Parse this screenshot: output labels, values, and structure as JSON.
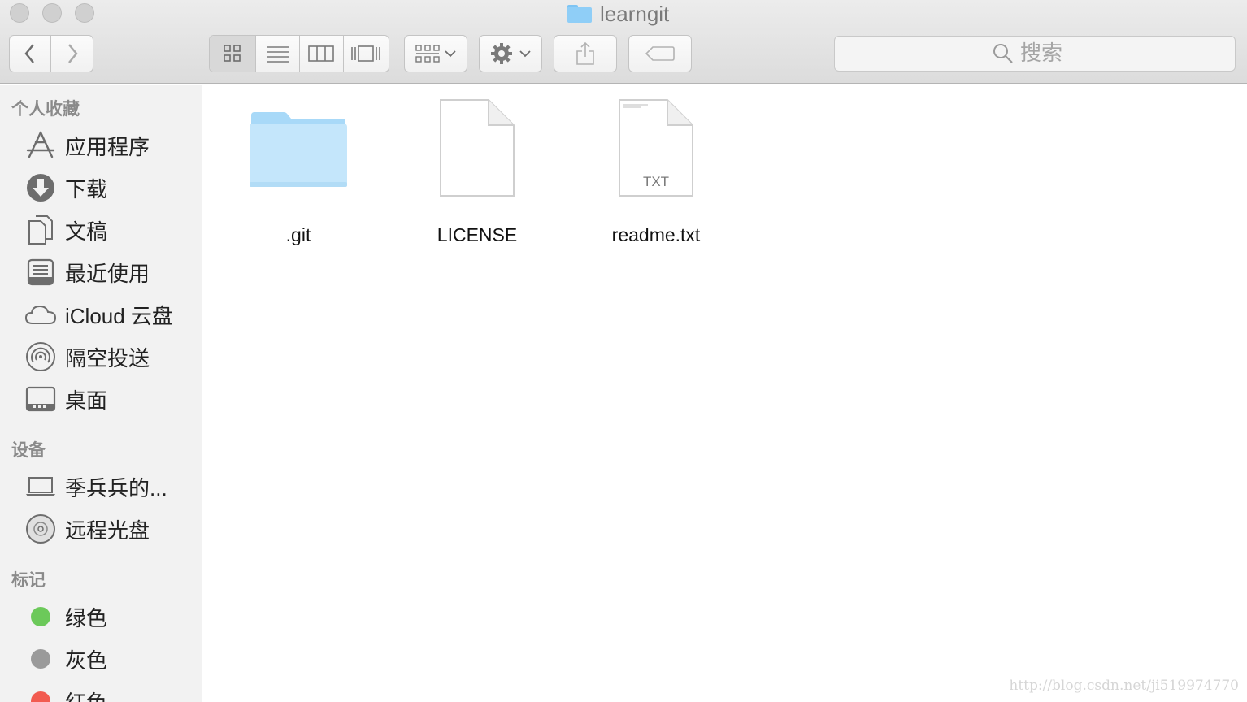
{
  "window": {
    "title": "learngit",
    "accent_color": "#8fcef7"
  },
  "toolbar": {
    "back_icon": "chevron-left-icon",
    "forward_icon": "chevron-right-icon",
    "view_modes": [
      "icon-view-icon",
      "list-view-icon",
      "column-view-icon",
      "cover-flow-icon"
    ],
    "arrange_icon": "arrange-grid-icon",
    "action_icon": "gear-icon",
    "share_icon": "share-icon",
    "tag_icon": "tag-icon",
    "search_placeholder": "搜索"
  },
  "sidebar": {
    "favorites_header": "个人收藏",
    "favorites": [
      {
        "label": "应用程序",
        "icon": "applications-icon"
      },
      {
        "label": "下载",
        "icon": "downloads-icon"
      },
      {
        "label": "文稿",
        "icon": "documents-icon"
      },
      {
        "label": "最近使用",
        "icon": "recents-icon"
      },
      {
        "label": "iCloud 云盘",
        "icon": "icloud-icon"
      },
      {
        "label": "隔空投送",
        "icon": "airdrop-icon"
      },
      {
        "label": "桌面",
        "icon": "desktop-icon"
      }
    ],
    "devices_header": "设备",
    "devices": [
      {
        "label": "季兵兵的...",
        "icon": "laptop-icon"
      },
      {
        "label": "远程光盘",
        "icon": "remote-disc-icon"
      }
    ],
    "tags_header": "标记",
    "tags": [
      {
        "label": "绿色",
        "color": "#6cc95a"
      },
      {
        "label": "灰色",
        "color": "#9a9a9a"
      },
      {
        "label": "红色",
        "color": "#f25b50"
      }
    ]
  },
  "files": [
    {
      "name": ".git",
      "kind": "folder",
      "icon": "folder-icon"
    },
    {
      "name": "LICENSE",
      "kind": "document",
      "icon": "document-icon"
    },
    {
      "name": "readme.txt",
      "kind": "text",
      "icon": "text-file-icon",
      "badge": "TXT"
    }
  ],
  "watermark": "http://blog.csdn.net/ji519974770"
}
